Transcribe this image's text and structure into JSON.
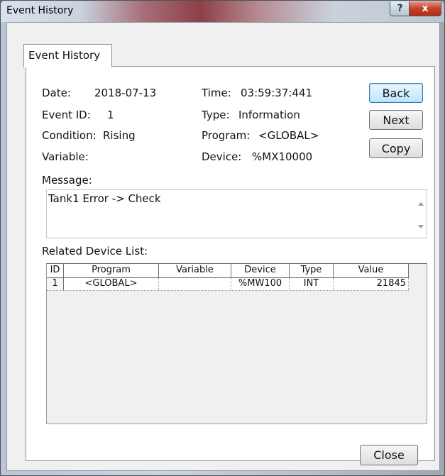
{
  "window": {
    "title": "Event History",
    "help_glyph": "?",
    "close_glyph": "x"
  },
  "tab": {
    "label": "Event History"
  },
  "details": {
    "date_label": "Date:",
    "date_value": "2018-07-13",
    "time_label": "Time:",
    "time_value": "03:59:37:441",
    "event_id_label": "Event ID:",
    "event_id_value": "1",
    "type_label": "Type:",
    "type_value": "Information",
    "condition_label": "Condition:",
    "condition_value": "Rising",
    "program_label": "Program:",
    "program_value": "<GLOBAL>",
    "variable_label": "Variable:",
    "variable_value": "",
    "device_label": "Device:",
    "device_value": "%MX10000"
  },
  "buttons": {
    "back": "Back",
    "next": "Next",
    "copy": "Copy",
    "close": "Close"
  },
  "message": {
    "label": "Message:",
    "text": "Tank1 Error -> Check"
  },
  "related": {
    "label": "Related Device List:",
    "columns": [
      "ID",
      "Program",
      "Variable",
      "Device",
      "Type",
      "Value"
    ],
    "rows": [
      [
        "1",
        "<GLOBAL>",
        "",
        "%MW100",
        "INT",
        "21845"
      ]
    ]
  }
}
